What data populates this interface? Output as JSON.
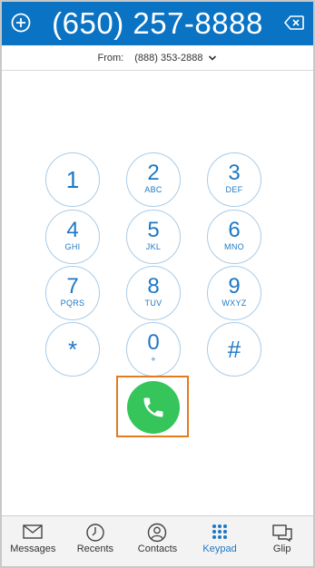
{
  "header": {
    "phone_number": "(650) 257-8888"
  },
  "from": {
    "label": "From:",
    "number": "(888) 353-2888"
  },
  "keys": [
    {
      "digit": "1",
      "letters": ""
    },
    {
      "digit": "2",
      "letters": "ABC"
    },
    {
      "digit": "3",
      "letters": "DEF"
    },
    {
      "digit": "4",
      "letters": "GHI"
    },
    {
      "digit": "5",
      "letters": "JKL"
    },
    {
      "digit": "6",
      "letters": "MNO"
    },
    {
      "digit": "7",
      "letters": "PQRS"
    },
    {
      "digit": "8",
      "letters": "TUV"
    },
    {
      "digit": "9",
      "letters": "WXYZ"
    },
    {
      "digit": "*",
      "letters": ""
    },
    {
      "digit": "0",
      "letters": "+"
    },
    {
      "digit": "#",
      "letters": ""
    }
  ],
  "tabs": [
    {
      "label": "Messages",
      "icon": "envelope-icon"
    },
    {
      "label": "Recents",
      "icon": "clock-icon"
    },
    {
      "label": "Contacts",
      "icon": "person-icon"
    },
    {
      "label": "Keypad",
      "icon": "keypad-icon",
      "active": true
    },
    {
      "label": "Glip",
      "icon": "chat-icon"
    }
  ],
  "colors": {
    "header": "#0a73c3",
    "accent": "#1d78c5",
    "call": "#35c55b",
    "highlight": "#e37b1f"
  }
}
